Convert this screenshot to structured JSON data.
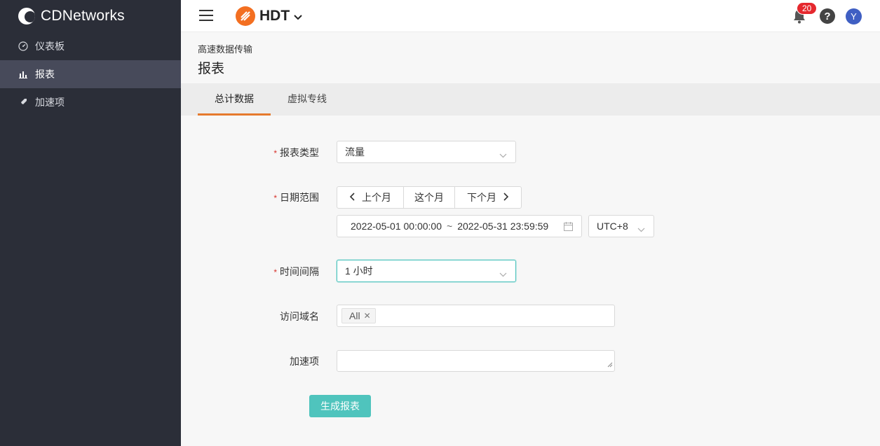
{
  "sidebar": {
    "brand": "CDNetworks",
    "items": [
      {
        "label": "仪表板",
        "icon": "dashboard-icon"
      },
      {
        "label": "报表",
        "icon": "bar-chart-icon",
        "active": true
      },
      {
        "label": "加速项",
        "icon": "rocket-icon"
      }
    ]
  },
  "header": {
    "product": "HDT",
    "notifications_count": "20",
    "help_label": "?",
    "avatar_initial": "Y"
  },
  "page": {
    "breadcrumb": "高速数据传输",
    "title": "报表"
  },
  "tabs": [
    {
      "label": "总计数据",
      "active": true
    },
    {
      "label": "虚拟专线",
      "active": false
    }
  ],
  "form": {
    "report_type": {
      "label": "报表类型",
      "required": true,
      "value": "流量"
    },
    "date_range": {
      "label": "日期范围",
      "required": true,
      "prev_month": "上个月",
      "this_month": "这个月",
      "next_month": "下个月",
      "start": "2022-05-01 00:00:00",
      "separator": "~",
      "end": "2022-05-31 23:59:59",
      "timezone": "UTC+8"
    },
    "interval": {
      "label": "时间间隔",
      "required": true,
      "value": "1 小时"
    },
    "domain": {
      "label": "访问域名",
      "tags": [
        "All"
      ]
    },
    "accel_item": {
      "label": "加速项",
      "value": ""
    },
    "submit_label": "生成报表"
  },
  "colors": {
    "sidebar_bg": "#2b2e38",
    "sidebar_active": "#474a5a",
    "accent_tab": "#e57a2d",
    "primary_button": "#4fc4bd",
    "badge": "#e5282e",
    "product_logo": "#f36f21"
  }
}
